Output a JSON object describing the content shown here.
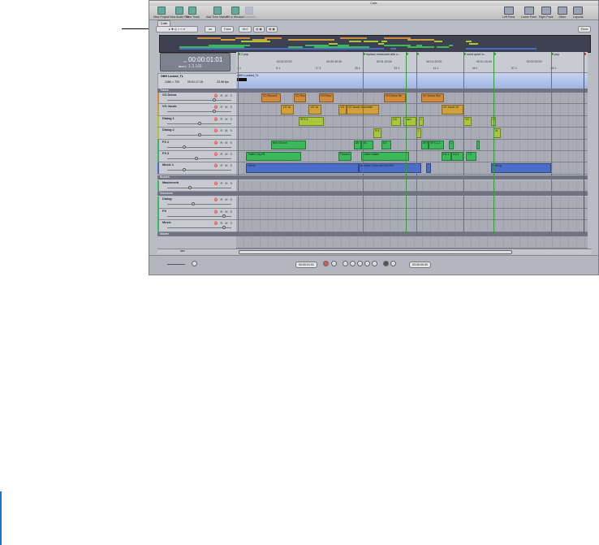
{
  "window": {
    "title": "Cafe",
    "tab": "Cafe"
  },
  "toolbar": {
    "left": [
      "New Project",
      "New Audio File",
      "New Track",
      "Add Time Marker",
      "Fit in Window",
      "Crossfade"
    ],
    "right": [
      "Left Pane",
      "Lower Pane",
      "Right Pane",
      "Mixer",
      "Layouts"
    ],
    "disabled": [
      "Crossfade"
    ]
  },
  "tools": {
    "track_select": "Track",
    "rate": "48.0",
    "show": "Show"
  },
  "time_display": {
    "tc_label": "TC",
    "timecode": "00:00:01:01",
    "beats_label": "BEATS",
    "beats": "1.3.166"
  },
  "ruler": {
    "time_labels": [
      "00:00:20:00",
      "00:00:40:00",
      "00:01:00:00",
      "00:01:20:00",
      "00:01:40:00",
      "00:02:00:00"
    ],
    "time_seconds": [
      20,
      40,
      60,
      80,
      100,
      120
    ],
    "beat_labels": [
      "1.1",
      "9.1",
      "17.1",
      "25.1",
      "33.1",
      "41.1",
      "49.1",
      "57.1",
      "65.1"
    ]
  },
  "markers": [
    {
      "label": "2 pop",
      "t": 0.6,
      "color": "#3a9a3a"
    },
    {
      "label": "replace restaurant with s...",
      "t": 50.6,
      "color": "#3a9a3a"
    },
    {
      "label": "",
      "t": 68,
      "color": "#3a9a3a"
    },
    {
      "label": "",
      "t": 72,
      "color": "#3a9a3a"
    },
    {
      "label": "need quiet ro...",
      "t": 91,
      "color": "#3a9a3a"
    },
    {
      "label": "",
      "t": 103,
      "color": "#3a9a3a"
    },
    {
      "label": "pop",
      "t": 126,
      "color": "#3a9a3a"
    },
    {
      "label": "",
      "t": 139,
      "color": "#c03030"
    }
  ],
  "video": {
    "name": "OHH Locked_TL",
    "size": "1280 × 720",
    "duration": "00:01:17:15",
    "fps": "23.98 fps",
    "clip": "OHH Locked_TL"
  },
  "sections": {
    "tracks": "Tracks",
    "busses": "Busses",
    "submixes": "Submixes",
    "master": "Master"
  },
  "tracks": [
    {
      "name": "VO Debra",
      "color": "#d08a3a",
      "vol": 0.75,
      "clips": [
        {
          "n": "VO Recordi",
          "s": 10,
          "d": 8
        },
        {
          "n": "VO Rec",
          "s": 23,
          "d": 5
        },
        {
          "n": "VO Reco",
          "s": 33,
          "d": 6
        },
        {
          "n": "VO Debra Re",
          "s": 59,
          "d": 9
        },
        {
          "n": "VO Debra Rec",
          "s": 74,
          "d": 9
        }
      ]
    },
    {
      "name": "VO Jacob",
      "color": "#d0a03a",
      "vol": 0.75,
      "clips": [
        {
          "n": "VO Ja",
          "s": 18,
          "d": 5
        },
        {
          "n": "VO Ja",
          "s": 29,
          "d": 5
        },
        {
          "n": "VO",
          "s": 41,
          "d": 3
        },
        {
          "n": "VO Jacob Jeannette",
          "s": 44,
          "d": 13
        },
        {
          "n": "VO Jacob Je",
          "s": 82,
          "d": 9
        }
      ]
    },
    {
      "name": "Dialog 1",
      "color": "#a8c83a",
      "vol": 0.5,
      "clips": [
        {
          "n": "SFX-1",
          "s": 25,
          "d": 10
        },
        {
          "n": "5.8",
          "s": 62,
          "d": 4
        },
        {
          "n": "Sara",
          "s": 67,
          "d": 5
        },
        {
          "n": "1",
          "s": 73,
          "d": 2
        },
        {
          "n": "VO",
          "s": 91,
          "d": 3
        },
        {
          "n": "O",
          "s": 102,
          "d": 2
        }
      ]
    },
    {
      "name": "Dialog 2",
      "color": "#a8c83a",
      "vol": 0.5,
      "clips": [
        {
          "n": "5.5",
          "s": 55,
          "d": 3
        },
        {
          "n": "1",
          "s": 72,
          "d": 2
        },
        {
          "n": "Al",
          "s": 103,
          "d": 3
        }
      ]
    },
    {
      "name": "FX 2",
      "color": "#3ab85a",
      "vol": 0.25,
      "clips": [
        {
          "n": "Bell Church",
          "s": 14,
          "d": 14
        },
        {
          "n": "Aft",
          "s": 47,
          "d": 3
        },
        {
          "n": "Aft-",
          "s": 50,
          "d": 5
        },
        {
          "n": "5.8",
          "s": 58,
          "d": 4
        },
        {
          "n": "SFX",
          "s": 74,
          "d": 3
        },
        {
          "n": "SFX-1-1",
          "s": 77,
          "d": 6
        },
        {
          "n": "1",
          "s": 85,
          "d": 2
        },
        {
          "n": "",
          "s": 96,
          "d": 1.5
        }
      ]
    },
    {
      "name": "FX 3",
      "color": "#3ab85a",
      "vol": 0.45,
      "clips": [
        {
          "n": "Traffic City Eff",
          "s": 4,
          "d": 22
        },
        {
          "n": "Passed",
          "s": 41,
          "d": 5
        },
        {
          "n": "Coffee Maker",
          "s": 50,
          "d": 19
        },
        {
          "n": "5.8-1",
          "s": 82,
          "d": 4
        },
        {
          "n": "5.8-1",
          "s": 86,
          "d": 5
        },
        {
          "n": "7.2",
          "s": 92,
          "d": 4
        }
      ]
    },
    {
      "name": "Music 1",
      "color": "#4a6ec8",
      "vol": 0.25,
      "clips": [
        {
          "n": "Remix",
          "s": 4,
          "d": 45
        },
        {
          "n": "Acoustic Guitar Bel Sol Ref",
          "s": 49,
          "d": 25
        },
        {
          "n": "",
          "s": 76,
          "d": 2
        },
        {
          "n": "Ending",
          "s": 102,
          "d": 24
        }
      ]
    }
  ],
  "busses": [
    {
      "name": "Mastreverb",
      "color": "#3ab85a",
      "vol": 0.35
    }
  ],
  "submixes": [
    {
      "name": "Dialog",
      "color": "#3ab85a",
      "vol": 0.4
    },
    {
      "name": "FX",
      "color": "#3ab85a",
      "vol": 0.9
    },
    {
      "name": "Music",
      "color": "#3ab85a",
      "vol": 0.9
    }
  ],
  "track_buttons": "♈ R M S",
  "bottom": {
    "unit": "sec"
  },
  "transport": {
    "playhead": "00:00:01:01",
    "end": "00:00:00:00"
  }
}
